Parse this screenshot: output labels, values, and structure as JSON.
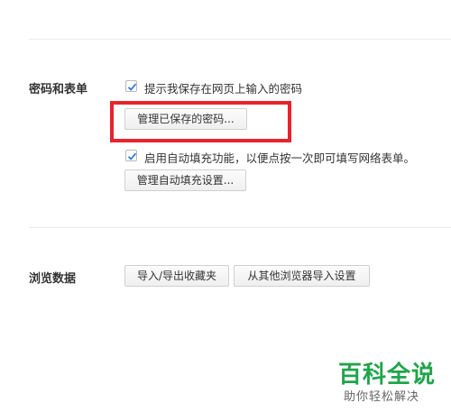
{
  "passwords_section": {
    "label": "密码和表单",
    "save_password_checkbox": {
      "label": "提示我保存在网页上输入的密码",
      "checked": true
    },
    "manage_passwords_button": "管理已保存的密码...",
    "autofill_checkbox": {
      "label": "启用自动填充功能，以便点按一次即可填写网络表单。",
      "checked": true
    },
    "manage_autofill_button": "管理自动填充设置..."
  },
  "browsing_data_section": {
    "label": "浏览数据",
    "import_export_bookmarks_button": "导入/导出收藏夹",
    "import_from_other_browser_button": "从其他浏览器导入设置"
  },
  "watermark": {
    "title": "百科全说",
    "subtitle": "助你轻松解决"
  },
  "colors": {
    "highlight": "#e8232e",
    "checkmark": "#2b7de0",
    "watermark_green": "#1fa64a"
  }
}
